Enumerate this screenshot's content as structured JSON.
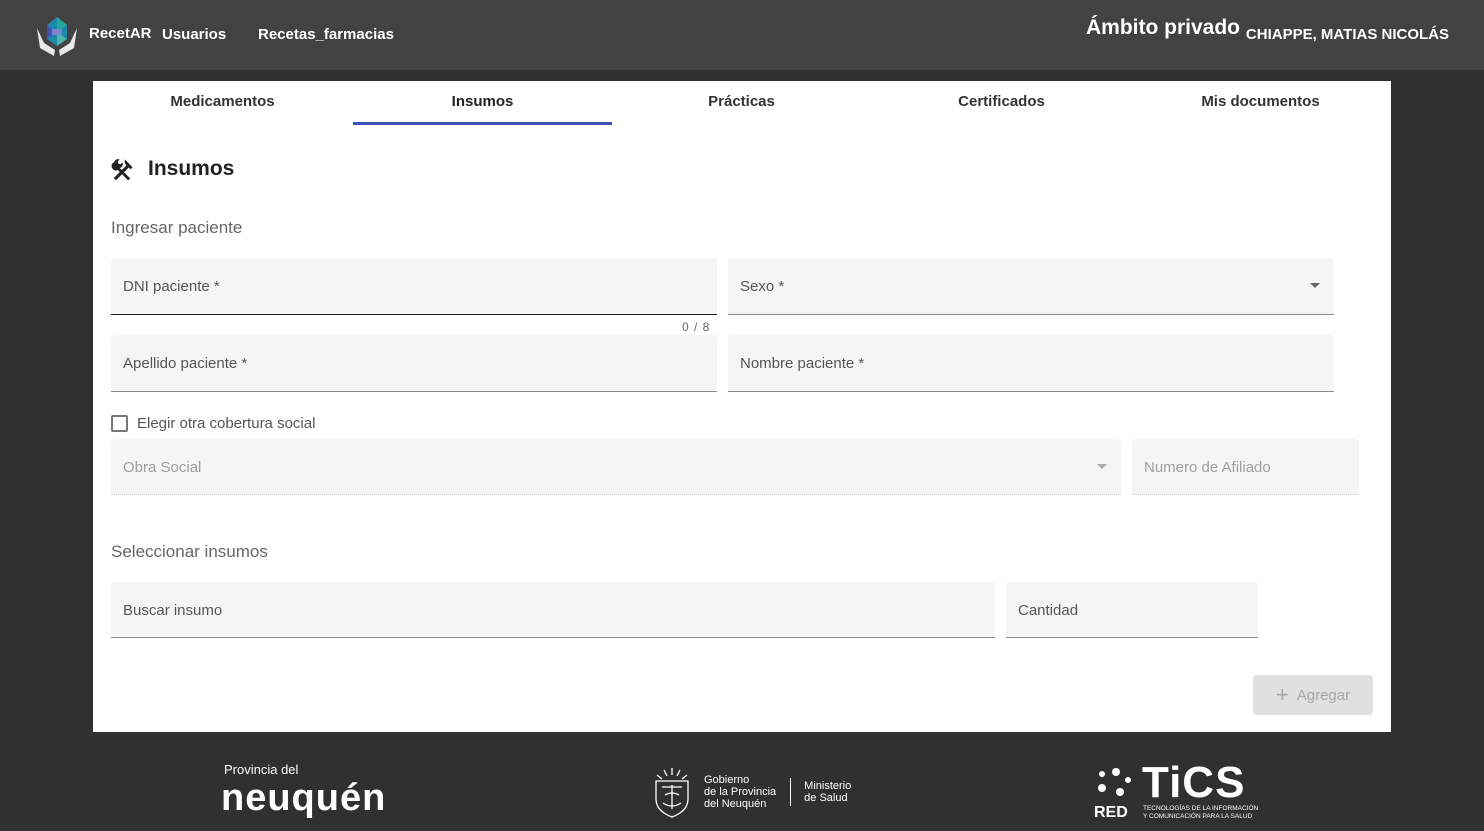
{
  "header": {
    "brand": "RecetAR",
    "nav": [
      "Usuarios",
      "Recetas_farmacias"
    ],
    "ambito": "Ámbito privado",
    "user_name": "CHIAPPE, MATIAS NICOLÁS"
  },
  "tabs": [
    "Medicamentos",
    "Insumos",
    "Prácticas",
    "Certificados",
    "Mis documentos"
  ],
  "active_tab": "Insumos",
  "section": {
    "title": "Insumos",
    "icon": "tools-icon"
  },
  "patient": {
    "heading": "Ingresar paciente",
    "dni_label": "DNI paciente *",
    "dni_counter": "0 / 8",
    "sexo_label": "Sexo *",
    "apellido_label": "Apellido paciente *",
    "nombre_label": "Nombre paciente *",
    "checkbox_label": "Elegir otra cobertura social",
    "obra_social_label": "Obra Social",
    "afiliado_label": "Numero de Afiliado"
  },
  "supplies": {
    "heading": "Seleccionar insumos",
    "search_label": "Buscar insumo",
    "quantity_label": "Cantidad",
    "add_button": "Agregar"
  },
  "footer": {
    "neuquen_small": "Provincia del",
    "neuquen_big": "neuquén",
    "gobierno_lines": [
      "Gobierno",
      "de la Provincia",
      "del Neuquén"
    ],
    "ministerio_lines": [
      "Ministerio",
      "de Salud"
    ],
    "tics_big": "TiCS",
    "tics_red": "RED",
    "tics_sub_lines": [
      "TECNOLOGÍAS DE LA INFORMACIÓN",
      "Y COMUNICACIÓN PARA LA SALUD"
    ]
  },
  "colors": {
    "topbar": "#424242",
    "background": "#303030",
    "accent": "#3f51b5",
    "field_bg": "#f5f5f5"
  }
}
